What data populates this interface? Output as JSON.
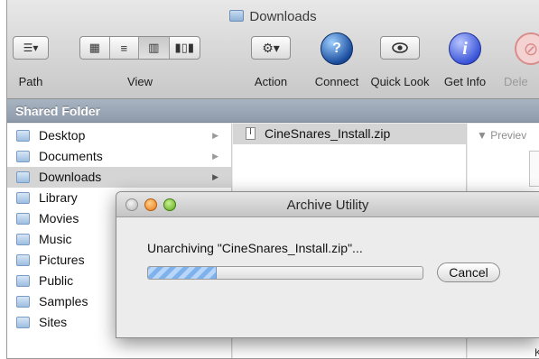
{
  "window": {
    "title": "Downloads"
  },
  "toolbar": {
    "path_label": "Path",
    "view_label": "View",
    "action_label": "Action",
    "connect_label": "Connect",
    "quicklook_label": "Quick Look",
    "getinfo_label": "Get Info",
    "delete_label": "Dele"
  },
  "sidebar_header": "Shared Folder",
  "column1": {
    "items": [
      {
        "label": "Desktop",
        "icon": "folder-icon"
      },
      {
        "label": "Documents",
        "icon": "folder-icon"
      },
      {
        "label": "Downloads",
        "icon": "folder-icon",
        "selected": true
      },
      {
        "label": "Library",
        "icon": "folder-icon"
      },
      {
        "label": "Movies",
        "icon": "folder-icon"
      },
      {
        "label": "Music",
        "icon": "folder-icon"
      },
      {
        "label": "Pictures",
        "icon": "folder-icon"
      },
      {
        "label": "Public",
        "icon": "folder-icon"
      },
      {
        "label": "Samples",
        "icon": "folder-icon"
      },
      {
        "label": "Sites",
        "icon": "folder-icon"
      }
    ]
  },
  "column2": {
    "file": "CineSnares_Install.zip"
  },
  "preview": {
    "label": "▼ Previev",
    "kind_char": "K"
  },
  "dialog": {
    "title": "Archive Utility",
    "message": "Unarchiving \"CineSnares_Install.zip\"...",
    "progress": 0.25,
    "cancel_label": "Cancel"
  },
  "colors": {
    "selection": "#d5d5d5",
    "shared_bar": "#98a4b3",
    "progress": "#7fb1ec"
  }
}
